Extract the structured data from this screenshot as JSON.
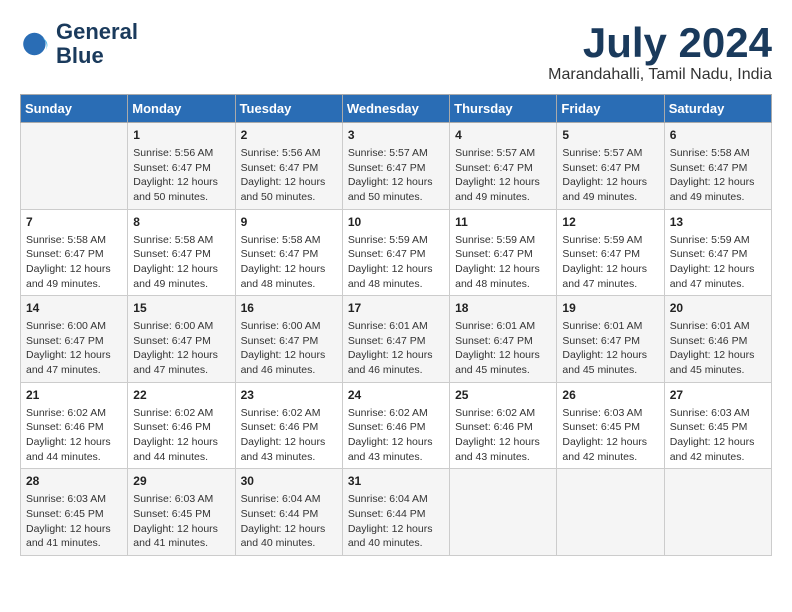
{
  "header": {
    "logo_line1": "General",
    "logo_line2": "Blue",
    "month_year": "July 2024",
    "location": "Marandahalli, Tamil Nadu, India"
  },
  "weekdays": [
    "Sunday",
    "Monday",
    "Tuesday",
    "Wednesday",
    "Thursday",
    "Friday",
    "Saturday"
  ],
  "weeks": [
    [
      {
        "day": "",
        "sunrise": "",
        "sunset": "",
        "daylight": ""
      },
      {
        "day": "1",
        "sunrise": "5:56 AM",
        "sunset": "6:47 PM",
        "daylight": "12 hours and 50 minutes."
      },
      {
        "day": "2",
        "sunrise": "5:56 AM",
        "sunset": "6:47 PM",
        "daylight": "12 hours and 50 minutes."
      },
      {
        "day": "3",
        "sunrise": "5:57 AM",
        "sunset": "6:47 PM",
        "daylight": "12 hours and 50 minutes."
      },
      {
        "day": "4",
        "sunrise": "5:57 AM",
        "sunset": "6:47 PM",
        "daylight": "12 hours and 49 minutes."
      },
      {
        "day": "5",
        "sunrise": "5:57 AM",
        "sunset": "6:47 PM",
        "daylight": "12 hours and 49 minutes."
      },
      {
        "day": "6",
        "sunrise": "5:58 AM",
        "sunset": "6:47 PM",
        "daylight": "12 hours and 49 minutes."
      }
    ],
    [
      {
        "day": "7",
        "sunrise": "5:58 AM",
        "sunset": "6:47 PM",
        "daylight": "12 hours and 49 minutes."
      },
      {
        "day": "8",
        "sunrise": "5:58 AM",
        "sunset": "6:47 PM",
        "daylight": "12 hours and 49 minutes."
      },
      {
        "day": "9",
        "sunrise": "5:58 AM",
        "sunset": "6:47 PM",
        "daylight": "12 hours and 48 minutes."
      },
      {
        "day": "10",
        "sunrise": "5:59 AM",
        "sunset": "6:47 PM",
        "daylight": "12 hours and 48 minutes."
      },
      {
        "day": "11",
        "sunrise": "5:59 AM",
        "sunset": "6:47 PM",
        "daylight": "12 hours and 48 minutes."
      },
      {
        "day": "12",
        "sunrise": "5:59 AM",
        "sunset": "6:47 PM",
        "daylight": "12 hours and 47 minutes."
      },
      {
        "day": "13",
        "sunrise": "5:59 AM",
        "sunset": "6:47 PM",
        "daylight": "12 hours and 47 minutes."
      }
    ],
    [
      {
        "day": "14",
        "sunrise": "6:00 AM",
        "sunset": "6:47 PM",
        "daylight": "12 hours and 47 minutes."
      },
      {
        "day": "15",
        "sunrise": "6:00 AM",
        "sunset": "6:47 PM",
        "daylight": "12 hours and 47 minutes."
      },
      {
        "day": "16",
        "sunrise": "6:00 AM",
        "sunset": "6:47 PM",
        "daylight": "12 hours and 46 minutes."
      },
      {
        "day": "17",
        "sunrise": "6:01 AM",
        "sunset": "6:47 PM",
        "daylight": "12 hours and 46 minutes."
      },
      {
        "day": "18",
        "sunrise": "6:01 AM",
        "sunset": "6:47 PM",
        "daylight": "12 hours and 45 minutes."
      },
      {
        "day": "19",
        "sunrise": "6:01 AM",
        "sunset": "6:47 PM",
        "daylight": "12 hours and 45 minutes."
      },
      {
        "day": "20",
        "sunrise": "6:01 AM",
        "sunset": "6:46 PM",
        "daylight": "12 hours and 45 minutes."
      }
    ],
    [
      {
        "day": "21",
        "sunrise": "6:02 AM",
        "sunset": "6:46 PM",
        "daylight": "12 hours and 44 minutes."
      },
      {
        "day": "22",
        "sunrise": "6:02 AM",
        "sunset": "6:46 PM",
        "daylight": "12 hours and 44 minutes."
      },
      {
        "day": "23",
        "sunrise": "6:02 AM",
        "sunset": "6:46 PM",
        "daylight": "12 hours and 43 minutes."
      },
      {
        "day": "24",
        "sunrise": "6:02 AM",
        "sunset": "6:46 PM",
        "daylight": "12 hours and 43 minutes."
      },
      {
        "day": "25",
        "sunrise": "6:02 AM",
        "sunset": "6:46 PM",
        "daylight": "12 hours and 43 minutes."
      },
      {
        "day": "26",
        "sunrise": "6:03 AM",
        "sunset": "6:45 PM",
        "daylight": "12 hours and 42 minutes."
      },
      {
        "day": "27",
        "sunrise": "6:03 AM",
        "sunset": "6:45 PM",
        "daylight": "12 hours and 42 minutes."
      }
    ],
    [
      {
        "day": "28",
        "sunrise": "6:03 AM",
        "sunset": "6:45 PM",
        "daylight": "12 hours and 41 minutes."
      },
      {
        "day": "29",
        "sunrise": "6:03 AM",
        "sunset": "6:45 PM",
        "daylight": "12 hours and 41 minutes."
      },
      {
        "day": "30",
        "sunrise": "6:04 AM",
        "sunset": "6:44 PM",
        "daylight": "12 hours and 40 minutes."
      },
      {
        "day": "31",
        "sunrise": "6:04 AM",
        "sunset": "6:44 PM",
        "daylight": "12 hours and 40 minutes."
      },
      {
        "day": "",
        "sunrise": "",
        "sunset": "",
        "daylight": ""
      },
      {
        "day": "",
        "sunrise": "",
        "sunset": "",
        "daylight": ""
      },
      {
        "day": "",
        "sunrise": "",
        "sunset": "",
        "daylight": ""
      }
    ]
  ]
}
